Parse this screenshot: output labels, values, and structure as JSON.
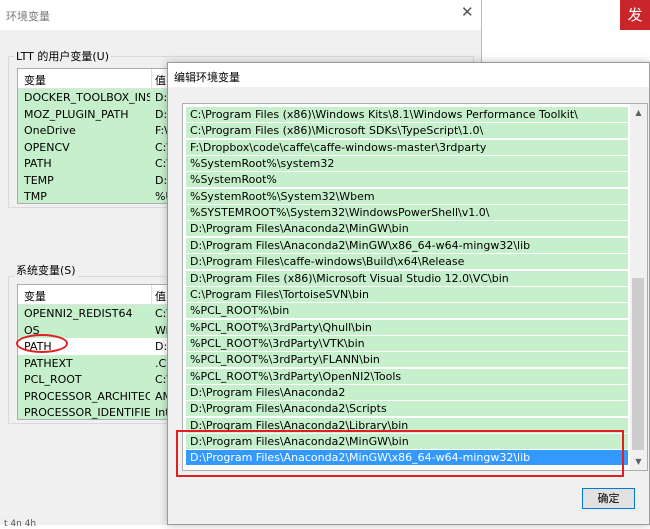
{
  "back_window": {
    "title": "环境变量",
    "close_glyph": "✕",
    "user_group": {
      "label": "LTT 的用户变量(U)",
      "headers": [
        "变量",
        "值"
      ],
      "rows": [
        {
          "name": "DOCKER_TOOLBOX_INST...",
          "value": "D:\\"
        },
        {
          "name": "MOZ_PLUGIN_PATH",
          "value": "D:\\"
        },
        {
          "name": "OneDrive",
          "value": "F:\\"
        },
        {
          "name": "OPENCV",
          "value": "C:\\"
        },
        {
          "name": "PATH",
          "value": "C:\\"
        },
        {
          "name": "TEMP",
          "value": "D:\\"
        },
        {
          "name": "TMP",
          "value": "%U"
        }
      ]
    },
    "system_group": {
      "label": "系统变量(S)",
      "headers": [
        "变量",
        "值"
      ],
      "rows": [
        {
          "name": "OPENNI2_REDIST64",
          "value": "C:\\"
        },
        {
          "name": "OS",
          "value": "Wi"
        },
        {
          "name": "PATH",
          "value": "D:\\"
        },
        {
          "name": "PATHEXT",
          "value": ".C"
        },
        {
          "name": "PCL_ROOT",
          "value": "C:\\"
        },
        {
          "name": "PROCESSOR_ARCHITECT...",
          "value": "AM"
        },
        {
          "name": "PROCESSOR_IDENTIFIER",
          "value": "Int"
        }
      ]
    },
    "bottom_fragment": "t 4n 4h"
  },
  "banner": {
    "text": "发",
    "color": "#c9252b"
  },
  "edit_dialog": {
    "title": "编辑环境变量",
    "items": [
      "C:\\Program Files (x86)\\Windows Kits\\8.1\\Windows Performance Toolkit\\",
      "C:\\Program Files (x86)\\Microsoft SDKs\\TypeScript\\1.0\\",
      "F:\\Dropbox\\code\\caffe\\caffe-windows-master\\3rdparty",
      "%SystemRoot%\\system32",
      "%SystemRoot%",
      "%SystemRoot%\\System32\\Wbem",
      "%SYSTEMROOT%\\System32\\WindowsPowerShell\\v1.0\\",
      "D:\\Program Files\\Anaconda2\\MinGW\\bin",
      "D:\\Program Files\\Anaconda2\\MinGW\\x86_64-w64-mingw32\\lib",
      "D:\\Program Files\\caffe-windows\\Build\\x64\\Release",
      "D:\\Program Files (x86)\\Microsoft Visual Studio 12.0\\VC\\bin",
      "C:\\Program Files\\TortoiseSVN\\bin",
      "%PCL_ROOT%\\bin",
      "%PCL_ROOT%\\3rdParty\\Qhull\\bin",
      "%PCL_ROOT%\\3rdParty\\VTK\\bin",
      "%PCL_ROOT%\\3rdParty\\FLANN\\bin",
      "%PCL_ROOT%\\3rdParty\\OpenNI2\\Tools",
      "D:\\Program Files\\Anaconda2",
      "D:\\Program Files\\Anaconda2\\Scripts",
      "D:\\Program Files\\Anaconda2\\Library\\bin",
      "D:\\Program Files\\Anaconda2\\MinGW\\bin",
      "D:\\Program Files\\Anaconda2\\MinGW\\x86_64-w64-mingw32\\lib"
    ],
    "selected_item": "D:\\Program Files\\Anaconda2\\MinGW\\x86_64-w64-mingw32\\lib",
    "ok_label": "确定",
    "scroll_up": "▲",
    "scroll_down": "▼"
  },
  "colors": {
    "row_highlight": "#c6efcb",
    "selection": "#3399ff",
    "annotation": "#e02020"
  }
}
